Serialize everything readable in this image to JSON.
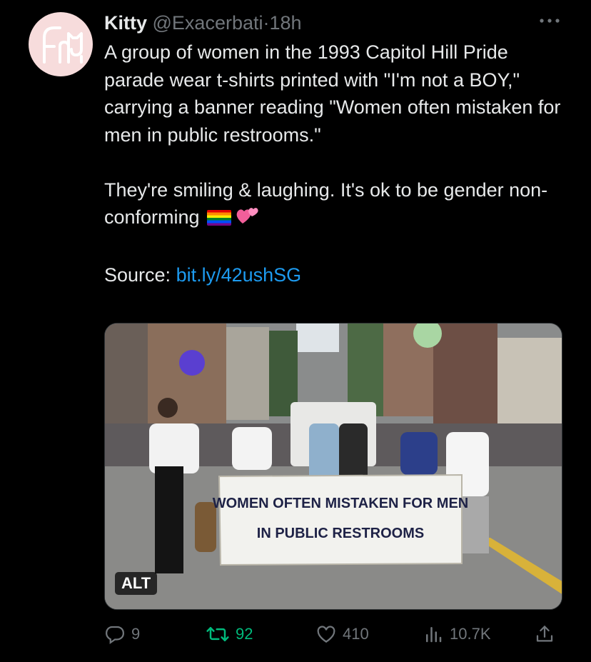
{
  "tweet": {
    "author_name": "Kitty",
    "author_handle": "@Exacerbati",
    "separator": "·",
    "time": "18h",
    "text_para1": "A group of women in the 1993 Capitol Hill Pride parade wear t-shirts printed with \"I'm not a BOY,\" carrying a banner reading \"Women often mistaken for men in public restrooms.\"",
    "text_para2": "They're smiling & laughing. It's ok to be gender non-conforming",
    "source_label": "Source:",
    "source_link": "bit.ly/42ushSG"
  },
  "media": {
    "banner_line1": "WOMEN OFTEN MISTAKEN FOR MEN",
    "banner_line2": "IN PUBLIC RESTROOMS",
    "alt_label": "ALT"
  },
  "actions": {
    "replies": "9",
    "retweets": "92",
    "likes": "410",
    "views": "10.7K"
  },
  "colors": {
    "background": "#000000",
    "text": "#e7e9ea",
    "muted": "#71767b",
    "link": "#1d9bf0",
    "retweet_active": "#00ba7c",
    "avatar_bg": "#f7dcdc"
  },
  "icons": [
    "cat-logo-icon",
    "more-icon",
    "rainbow-flag-icon",
    "two-hearts-icon",
    "reply-icon",
    "retweet-icon",
    "like-icon",
    "views-icon",
    "share-icon"
  ]
}
